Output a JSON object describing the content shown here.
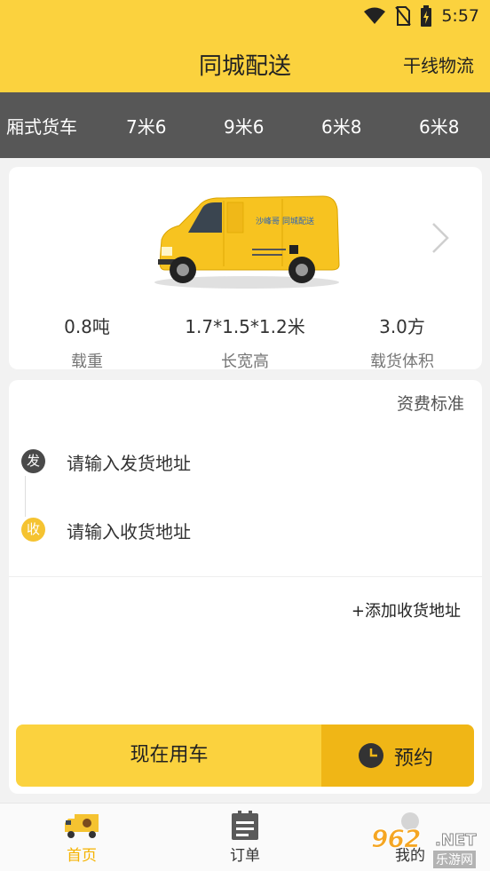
{
  "status_bar": {
    "time": "5:57"
  },
  "header": {
    "title": "同城配送",
    "right_link": "干线物流"
  },
  "truck_tabs": [
    "厢式货车",
    "7米6",
    "9米6",
    "6米8",
    "6米8"
  ],
  "vehicle": {
    "van_text": {
      "brand": "沙峰哥",
      "tagline": "同城配送"
    },
    "specs": [
      {
        "value": "0.8吨",
        "label": "载重"
      },
      {
        "value": "1.7*1.5*1.2米",
        "label": "长宽高"
      },
      {
        "value": "3.0方",
        "label": "载货体积"
      }
    ]
  },
  "order": {
    "fee_link": "资费标准",
    "sender": {
      "badge": "发",
      "placeholder": "请输入发货地址"
    },
    "receiver": {
      "badge": "收",
      "placeholder": "请输入收货地址"
    },
    "add_address": "+添加收货地址",
    "btn_now": "现在用车",
    "btn_reserve": "预约"
  },
  "tab_bar": [
    {
      "label": "首页",
      "active": true
    },
    {
      "label": "订单",
      "active": false
    },
    {
      "label": "我的",
      "active": false
    }
  ],
  "watermark": {
    "num": "962",
    "net": ".NET",
    "cn": "乐游网"
  },
  "colors": {
    "primary": "#fbd23e",
    "reserve": "#f0b616",
    "dark_bar": "#575757",
    "active_tab": "#f5b300",
    "sender_dot": "#4a4a4a",
    "receiver_dot": "#f5c331"
  }
}
